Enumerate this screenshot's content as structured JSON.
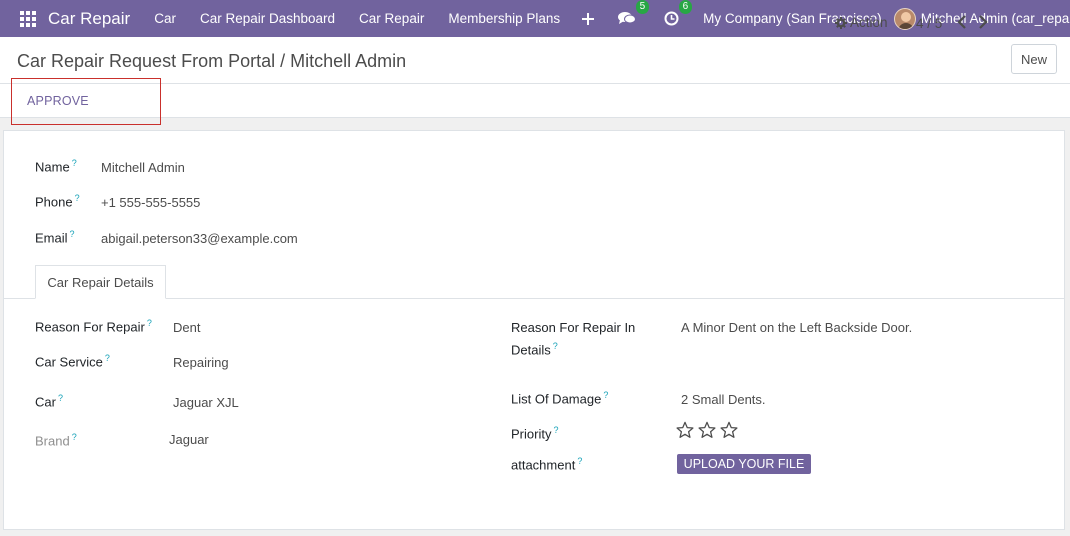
{
  "navbar": {
    "app_name": "Car Repair",
    "menu": [
      "Car",
      "Car Repair Dashboard",
      "Car Repair",
      "Membership Plans"
    ],
    "messages_count": "5",
    "activities_count": "6",
    "company": "My Company (San Francisco)",
    "user": "Mitchell Admin (car_repair_de",
    "icons": [
      "apps-grid-icon",
      "plus-icon",
      "chat-icon",
      "clock-icon",
      "avatar"
    ]
  },
  "control": {
    "breadcrumb_parent": "Car Repair Request From Portal",
    "breadcrumb_sep": " / ",
    "breadcrumb_current": "Mitchell Admin",
    "action_label": "Action",
    "pager": "4 / 5",
    "new_label": "New"
  },
  "statusbar": {
    "approve_label": "APPROVE"
  },
  "form": {
    "name_label": "Name",
    "name_value": "Mitchell Admin",
    "phone_label": "Phone",
    "phone_value": "+1 555-555-5555",
    "email_label": "Email",
    "email_value": "abigail.peterson33@example.com",
    "tab_label": "Car Repair Details",
    "reason_label": "Reason For Repair",
    "reason_value": "Dent",
    "service_label": "Car Service",
    "service_value": "Repairing",
    "car_label": "Car",
    "car_value": "Jaguar XJL",
    "brand_label": "Brand",
    "brand_value": "Jaguar",
    "reason_details_label_1": "Reason For Repair In",
    "reason_details_label_2": "Details",
    "reason_details_value": "A Minor Dent on the Left Backside Door.",
    "damage_label": "List Of Damage",
    "damage_value": "2 Small Dents.",
    "priority_label": "Priority",
    "priority_stars": 0,
    "priority_max": 3,
    "attachment_label": "attachment",
    "upload_label": "UPLOAD YOUR FILE",
    "help_mark": "?"
  },
  "colors": {
    "brand": "#71639e",
    "badge": "#28a745",
    "highlight_border": "#c9302c"
  }
}
